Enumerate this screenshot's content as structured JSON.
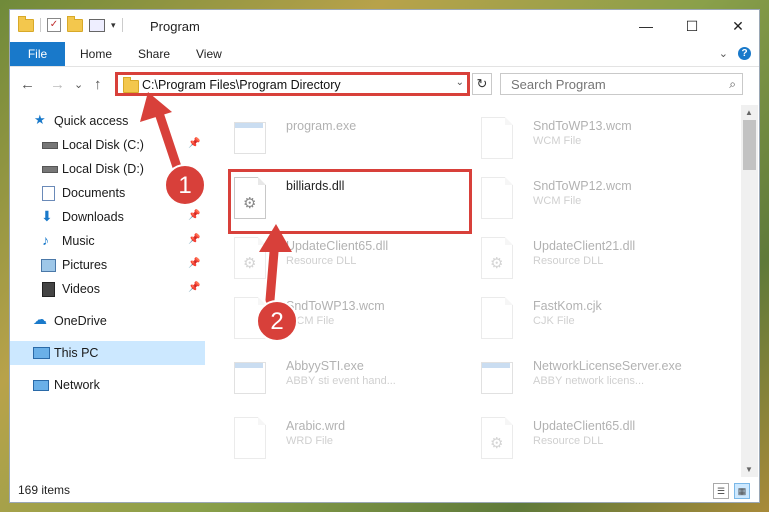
{
  "window": {
    "title": "Program",
    "minimize": "—",
    "maximize": "☐",
    "close": "✕"
  },
  "ribbon": {
    "tabs": [
      "File",
      "Home",
      "Share",
      "View"
    ]
  },
  "nav": {
    "back": "←",
    "forward": "→",
    "recent": "⌄",
    "up": "↑",
    "address": "C:\\Program Files\\Program Directory",
    "refresh": "↻",
    "search_placeholder": "Search Program"
  },
  "sidebar": {
    "items": [
      {
        "label": "Quick access",
        "icon": "star-icon"
      },
      {
        "label": "Local Disk (C:)",
        "icon": "drive-icon",
        "pinned": true
      },
      {
        "label": "Local Disk (D:)",
        "icon": "drive-icon"
      },
      {
        "label": "Documents",
        "icon": "documents-icon",
        "pinned": true
      },
      {
        "label": "Downloads",
        "icon": "download-icon",
        "pinned": true
      },
      {
        "label": "Music",
        "icon": "music-icon",
        "pinned": true
      },
      {
        "label": "Pictures",
        "icon": "pictures-icon",
        "pinned": true
      },
      {
        "label": "Videos",
        "icon": "videos-icon",
        "pinned": true
      },
      {
        "label": "OneDrive",
        "icon": "cloud-icon"
      },
      {
        "label": "This PC",
        "icon": "computer-icon",
        "selected": true
      },
      {
        "label": "Network",
        "icon": "network-icon"
      }
    ]
  },
  "files": [
    {
      "name": "program.exe",
      "type": "",
      "icon": "exe-icon"
    },
    {
      "name": "SndToWP13.wcm",
      "type": "WCM File",
      "icon": "doc-icon"
    },
    {
      "name": "billiards.dll",
      "type": "",
      "icon": "dll-icon",
      "highlighted": true
    },
    {
      "name": "SndToWP12.wcm",
      "type": "WCM File",
      "icon": "doc-icon"
    },
    {
      "name": "UpdateClient65.dll",
      "type": "Resource DLL",
      "icon": "dll-icon"
    },
    {
      "name": "UpdateClient21.dll",
      "type": "Resource DLL",
      "icon": "dll-icon"
    },
    {
      "name": "SndToWP13.wcm",
      "type": "WCM File",
      "icon": "doc-icon"
    },
    {
      "name": "FastKom.cjk",
      "type": "CJK File",
      "icon": "doc-icon"
    },
    {
      "name": "AbbyySTI.exe",
      "type": "ABBY sti event hand...",
      "icon": "exe-icon"
    },
    {
      "name": "NetworkLicenseServer.exe",
      "type": "ABBY network licens...",
      "icon": "exe-icon"
    },
    {
      "name": "Arabic.wrd",
      "type": "WRD File",
      "icon": "doc-icon"
    },
    {
      "name": "UpdateClient65.dll",
      "type": "Resource DLL",
      "icon": "dll-icon"
    }
  ],
  "annotations": {
    "step1": "1",
    "step2": "2",
    "color": "#d8403a"
  },
  "status": {
    "item_count": "169 items"
  }
}
